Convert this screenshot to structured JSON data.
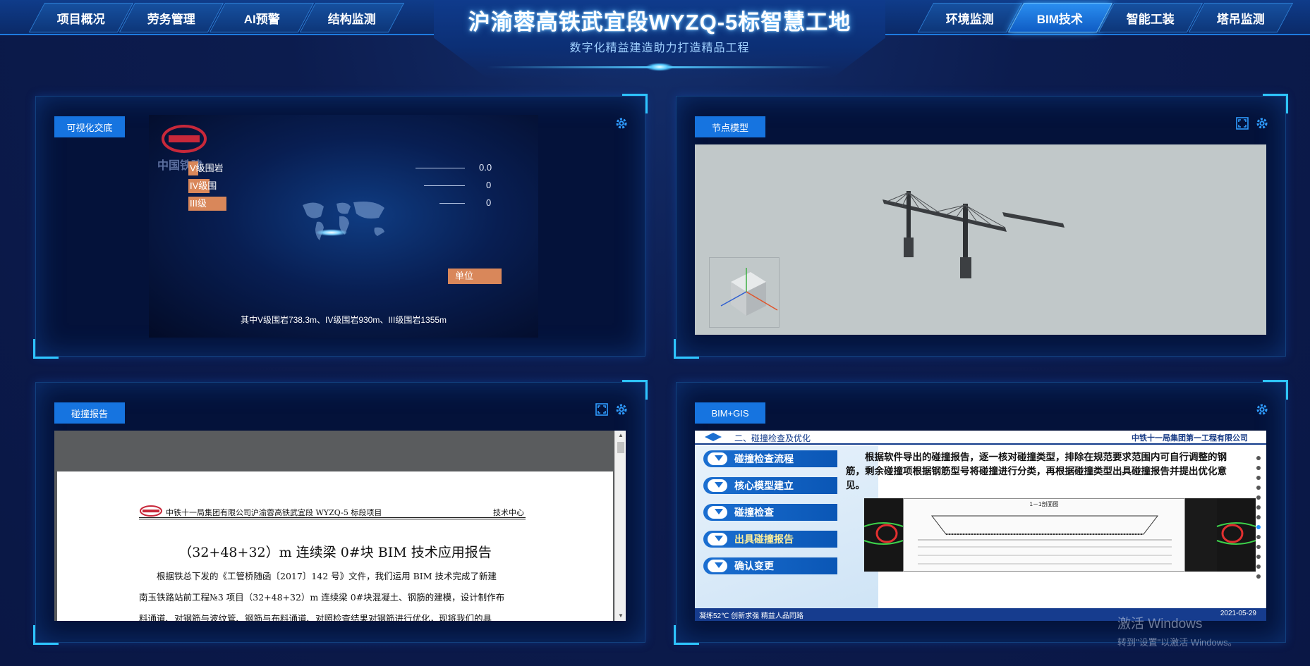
{
  "header": {
    "title": "沪渝蓉高铁武宜段WYZQ-5标智慧工地",
    "subtitle": "数字化精益建造助力打造精品工程",
    "nav_left": [
      "项目概况",
      "劳务管理",
      "AI预警",
      "结构监测"
    ],
    "nav_right": [
      "环境监测",
      "BIM技术",
      "智能工装",
      "塔吊监测"
    ],
    "active_tab": "BIM技术"
  },
  "panels": {
    "visual": {
      "label": "可视化交底",
      "logo_text": "中国铁建",
      "rows": [
        {
          "name": "V级围岩",
          "value": "0.0"
        },
        {
          "name": "IV级围",
          "value": "0"
        },
        {
          "name": "III级",
          "value": "0"
        }
      ],
      "unit_label": "单位",
      "caption": "其中V级围岩738.3m、IV级围岩930m、III级围岩1355m"
    },
    "node_model": {
      "label": "节点模型"
    },
    "clash_report": {
      "label": "碰撞报告",
      "doc_company": "中铁十一局集团有限公司沪渝蓉高铁武宜段 WYZQ-5 标段项目",
      "doc_dept": "技术中心",
      "doc_title": "（32+48+32）m 连续梁 0#块 BIM 技术应用报告",
      "doc_para1": "根据铁总下发的《工管桥随函〔2017〕142 号》文件，我们运用 BIM 技术完成了新建",
      "doc_para2": "南玉铁路站前工程№3 项目（32+48+32）m 连续梁 0#块混凝土、钢筋的建模，设计制作布",
      "doc_para3": "料通道、对钢筋与波纹管、钢筋与布料通道、对照检查结果对钢筋进行优化，现将我们的具"
    },
    "bim_gis": {
      "label": "BIM+GIS",
      "section": "二、碰撞检查及优化",
      "company": "中铁十一局集团第一工程有限公司",
      "steps": [
        "碰撞检查流程",
        "核心模型建立",
        "碰撞检查",
        "出具碰撞报告",
        "确认变更"
      ],
      "text": "根据软件导出的碰撞报告，逐一核对碰撞类型，排除在规范要求范围内可自行调整的钢筋，剩余碰撞项根据钢筋型号将碰撞进行分类，再根据碰撞类型出具碰撞报告并提出优化意见。",
      "drawing_title": "1－1剖面图",
      "footer_left": "凝练52℃ 创新求强 精益人品同路",
      "footer_date": "2021-05-29"
    }
  },
  "watermark": {
    "line1": "激活 Windows",
    "line2": "转到\"设置\"以激活 Windows。"
  },
  "colors": {
    "accent": "#1674e0",
    "active_nav": "#2a8ef0",
    "rock_bar": "#d9875a",
    "corner": "#2ec4ff"
  }
}
